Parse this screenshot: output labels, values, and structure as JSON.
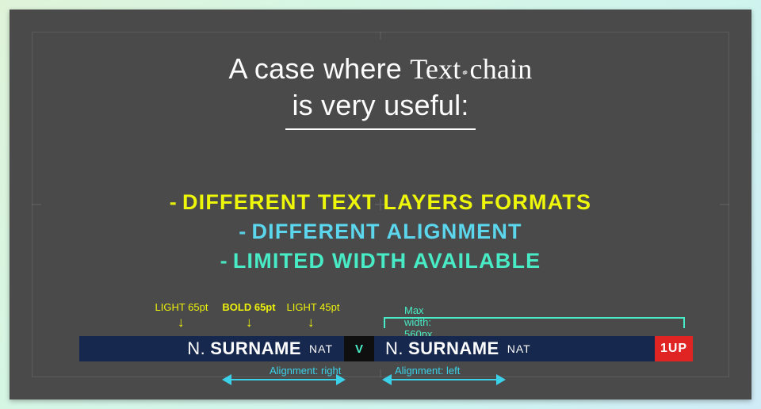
{
  "title": {
    "line1_pre": "A case where ",
    "line1_serif1": "Text",
    "line1_serif2": "chain",
    "line2": "is very useful:"
  },
  "bullets": {
    "b1": "Different text layers formats",
    "b2": "Different alignment",
    "b3": "Limited width available",
    "dash": "-"
  },
  "annotations": {
    "light65": "LIGHT 65pt",
    "bold65": "BOLD 65pt",
    "light45": "LIGHT 45pt",
    "maxwidth": "Max width: 560px",
    "align_right": "Alignment: right",
    "align_left": "Alignment: left"
  },
  "scorebar": {
    "left": {
      "initial": "N.",
      "surname": "SURNAME",
      "nat": "NAT"
    },
    "vs": "V",
    "right": {
      "initial": "N.",
      "surname": "SURNAME",
      "nat": "NAT"
    },
    "badge": "1UP"
  },
  "colors": {
    "yellow": "#eef60a",
    "cyan": "#5bd6ed",
    "teal": "#48ebc5",
    "navy": "#17284e",
    "red": "#e02424"
  }
}
